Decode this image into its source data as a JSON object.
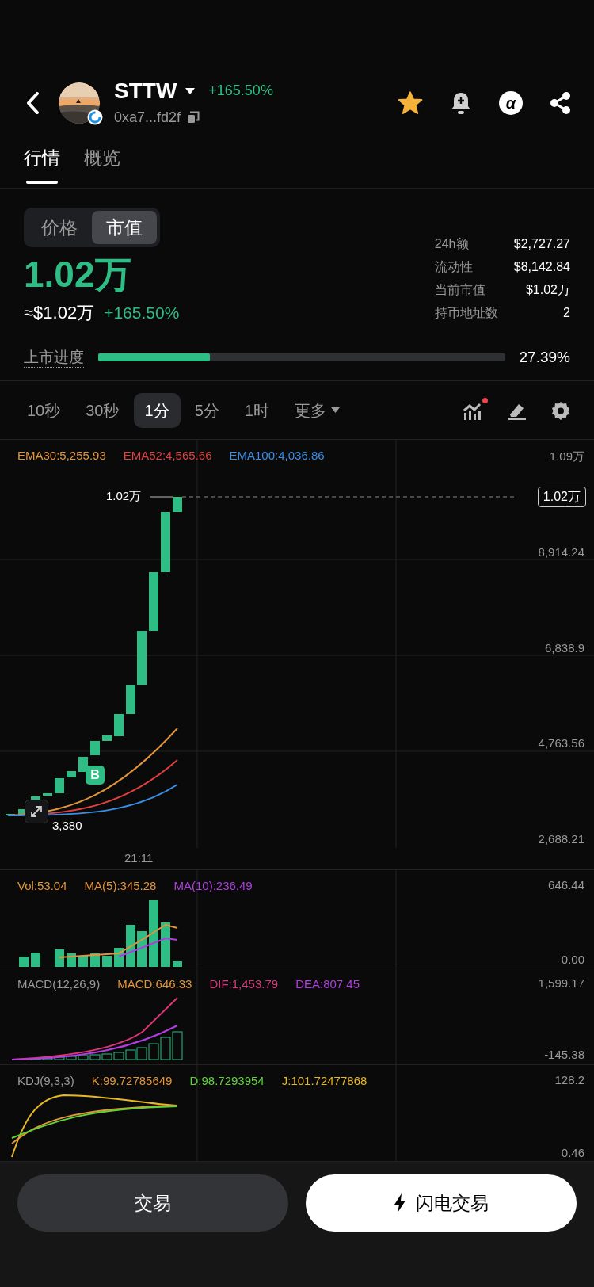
{
  "header": {
    "token": "STTW",
    "change": "+165.50%",
    "address": "0xa7...fd2f",
    "favorite": true,
    "alpha_label": "α"
  },
  "tabs": [
    {
      "label": "行情",
      "selected": true
    },
    {
      "label": "概览",
      "selected": false
    }
  ],
  "mode_toggle": [
    {
      "label": "价格",
      "selected": false
    },
    {
      "label": "市值",
      "selected": true
    }
  ],
  "value": "1.02万",
  "usd_value": "≈$1.02万",
  "value_change": "+165.50%",
  "stats": [
    {
      "label": "24h额",
      "value": "$2,727.27"
    },
    {
      "label": "流动性",
      "value": "$8,142.84"
    },
    {
      "label": "当前市值",
      "value": "$1.02万"
    },
    {
      "label": "持币地址数",
      "value": "2"
    }
  ],
  "listing_progress": {
    "label": "上市进度",
    "level": 0.2739,
    "reading": "27.39%"
  },
  "intervals": [
    {
      "label": "10秒",
      "selected": false,
      "kind": "plain"
    },
    {
      "label": "30秒",
      "selected": false,
      "kind": "plain"
    },
    {
      "label": "1分",
      "selected": true,
      "kind": "plain"
    },
    {
      "label": "5分",
      "selected": false,
      "kind": "plain"
    },
    {
      "label": "1时",
      "selected": false,
      "kind": "plain"
    },
    {
      "label": "更多",
      "selected": false,
      "kind": "dropdown"
    }
  ],
  "indicator_alert": true,
  "main_chart": {
    "legend": [
      {
        "label": "EMA30:5,255.93",
        "color": "#e3953a"
      },
      {
        "label": "EMA52:4,565.66",
        "color": "#e0403e"
      },
      {
        "label": "EMA100:4,036.86",
        "color": "#3a8ee6"
      }
    ],
    "y_labels": [
      "1.09万",
      "8,914.24",
      "6,838.9",
      "4,763.56",
      "2,688.21"
    ],
    "last_price": "1.02万",
    "high_label": "1.02万",
    "low_label": "3,380",
    "marker": "B",
    "time_label": "21:11"
  },
  "volume": {
    "legend": [
      {
        "label": "Vol:53.04",
        "color": "#e3953a"
      },
      {
        "label": "MA(5):345.28",
        "color": "#e3953a"
      },
      {
        "label": "MA(10):236.49",
        "color": "#b13ee0"
      }
    ],
    "y_labels": [
      "646.44",
      "0.00"
    ]
  },
  "macd": {
    "legend": [
      {
        "label": "MACD(12,26,9)",
        "color": "#9a9a9a"
      },
      {
        "label": "MACD:646.33",
        "color": "#e3953a"
      },
      {
        "label": "DIF:1,453.79",
        "color": "#e0357a"
      },
      {
        "label": "DEA:807.45",
        "color": "#b13ee0"
      }
    ],
    "y_labels": [
      "1,599.17",
      "-145.38"
    ]
  },
  "kdj": {
    "legend": [
      {
        "label": "KDJ(9,3,3)",
        "color": "#9a9a9a"
      },
      {
        "label": "K:99.72785649",
        "color": "#e3953a"
      },
      {
        "label": "D:98.7293954",
        "color": "#5fd43a"
      },
      {
        "label": "J:101.72477868",
        "color": "#e8b822"
      }
    ],
    "y_labels": [
      "128.2",
      "0.46"
    ]
  },
  "buttons": [
    {
      "label": "交易",
      "kind": "secondary"
    },
    {
      "label": "闪电交易",
      "kind": "flash"
    }
  ]
}
